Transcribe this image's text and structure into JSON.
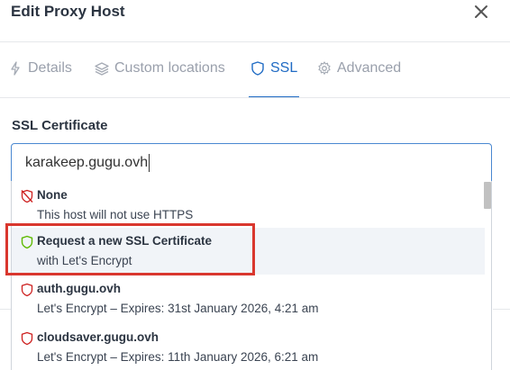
{
  "dialog": {
    "title": "Edit Proxy Host",
    "close_icon": "close-icon"
  },
  "tabs": [
    {
      "label": "Details",
      "icon": "lightning-icon",
      "active": false
    },
    {
      "label": "Custom locations",
      "icon": "layers-icon",
      "active": false
    },
    {
      "label": "SSL",
      "icon": "shield-icon",
      "active": true
    },
    {
      "label": "Advanced",
      "icon": "gear-icon",
      "active": false
    }
  ],
  "ssl": {
    "section_label": "SSL Certificate",
    "input_value": "karakeep.gugu.ovh",
    "options": [
      {
        "title": "None",
        "subtitle": "This host will not use HTTPS",
        "icon": "shield-off-icon",
        "icon_color": "#cd201f"
      },
      {
        "title": "Request a new SSL Certificate",
        "subtitle": "with Let's Encrypt",
        "icon": "shield-icon",
        "icon_color": "#5eba00",
        "highlighted": true
      },
      {
        "title": "auth.gugu.ovh",
        "subtitle": "Let's Encrypt – Expires: 31st January 2026, 4:21 am",
        "icon": "shield-icon",
        "icon_color": "#cd201f"
      },
      {
        "title": "cloudsaver.gugu.ovh",
        "subtitle": "Let's Encrypt – Expires: 11th January 2026, 6:21 am",
        "icon": "shield-icon",
        "icon_color": "#cd201f"
      }
    ]
  },
  "colors": {
    "accent": "#206bc4",
    "annotation_box": "#d9372e",
    "muted_tab": "#9aa0ac"
  }
}
